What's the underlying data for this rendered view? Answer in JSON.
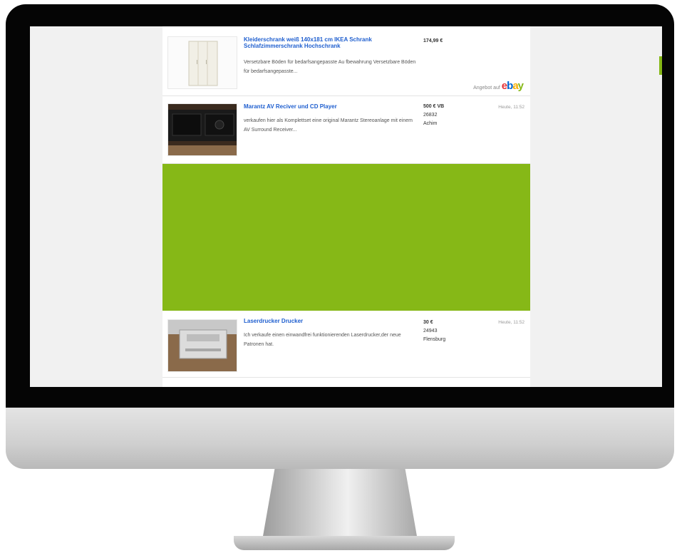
{
  "listings": [
    {
      "title": "Kleiderschrank weiß 140x181 cm IKEA Schrank Schlafzimmerschrank Hochschrank",
      "desc": "Versetzbare Böden für bedarfsangepasste Au fbewahrung Versetzbare Böden für bedarfsangepasste...",
      "price": "174,99 €",
      "offer_label": "Angebot auf",
      "offer_brand": "ebay"
    },
    {
      "title": "Marantz AV Reciver und CD Player",
      "desc": "verkaufen hier als Komplettset eine original Marantz Stereoanlage mit einem AV Surround Receiver...",
      "price": "500 € VB",
      "zip": "26832",
      "city": "Achim",
      "date": "Heute, 11:52"
    },
    {
      "title": "Laserdrucker Drucker",
      "desc": "Ich verkaufe einen einwandfrei funktionierenden Laserdrucker,der neue Patronen hat.",
      "price": "30 €",
      "zip": "24943",
      "city": "Flensburg",
      "date": "Heute, 11:52"
    }
  ],
  "colors": {
    "ad_block": "#86b817",
    "title_link": "#1f5fcf",
    "ebay_e": "#e53238",
    "ebay_b": "#0064d2",
    "ebay_a": "#f5af02",
    "ebay_y": "#86b817"
  }
}
